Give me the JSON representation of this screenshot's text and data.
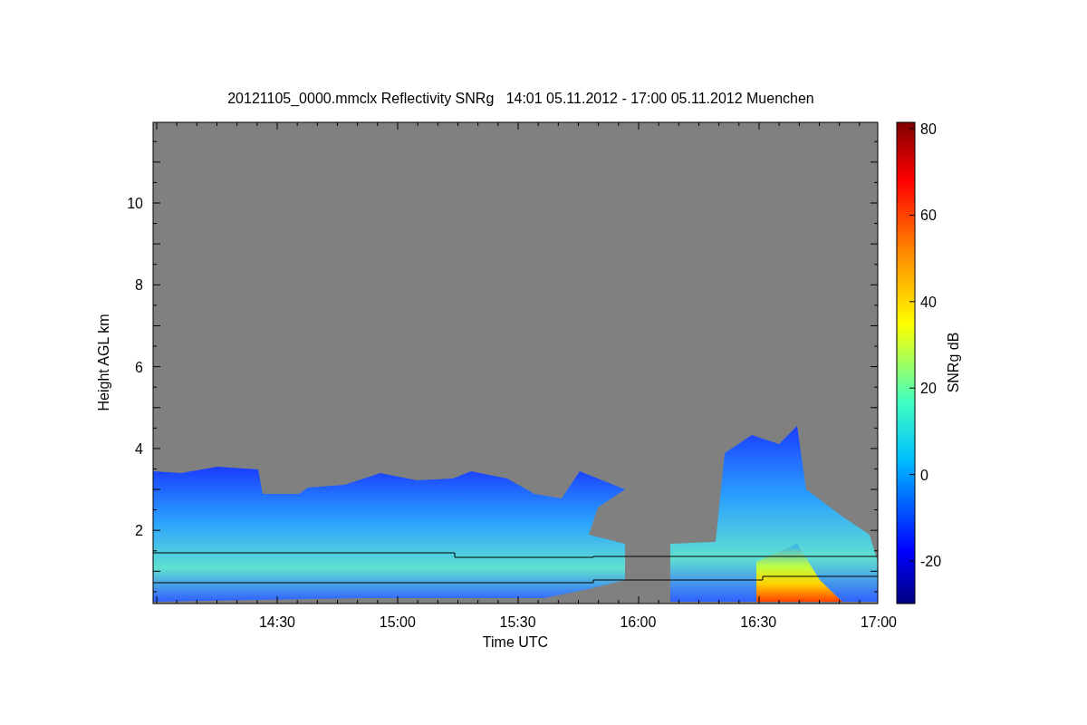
{
  "title": "20121105_0000.mmclx Reflectivity SNRg   14:01 05.11.2012 - 17:00 05.11.2012 Muenchen",
  "plot": {
    "xlabel": "Time UTC",
    "ylabel": "Height AGL km",
    "xtick_labels": [
      "14:30",
      "15:00",
      "15:30",
      "16:00",
      "16:30",
      "17:00"
    ],
    "ytick_labels": [
      "10",
      "8",
      "6",
      "4",
      "2"
    ]
  },
  "colorbar": {
    "label": "SNRg dB",
    "tick_labels": [
      "80",
      "60",
      "40",
      "20",
      "0",
      "-20"
    ]
  }
}
